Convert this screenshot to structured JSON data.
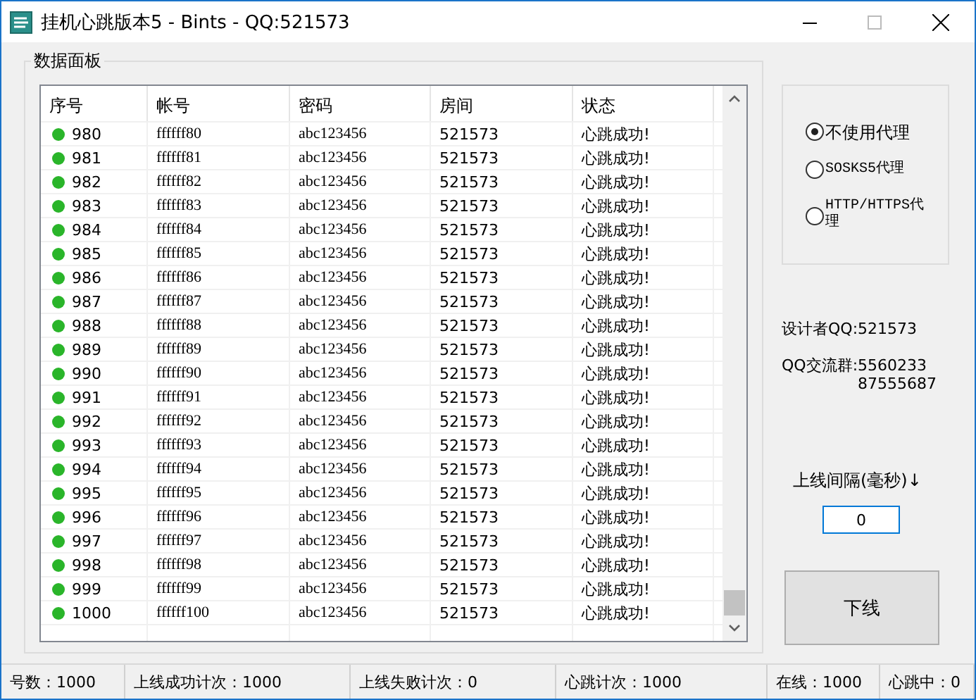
{
  "window": {
    "title": "挂机心跳版本5 - Bints - QQ:521573"
  },
  "panel": {
    "title": "数据面板"
  },
  "table": {
    "columns": [
      "序号",
      "帐号",
      "密码",
      "房间",
      "状态"
    ],
    "rows": [
      [
        "980",
        "ffffff80",
        "abc123456",
        "521573",
        "心跳成功!"
      ],
      [
        "981",
        "ffffff81",
        "abc123456",
        "521573",
        "心跳成功!"
      ],
      [
        "982",
        "ffffff82",
        "abc123456",
        "521573",
        "心跳成功!"
      ],
      [
        "983",
        "ffffff83",
        "abc123456",
        "521573",
        "心跳成功!"
      ],
      [
        "984",
        "ffffff84",
        "abc123456",
        "521573",
        "心跳成功!"
      ],
      [
        "985",
        "ffffff85",
        "abc123456",
        "521573",
        "心跳成功!"
      ],
      [
        "986",
        "ffffff86",
        "abc123456",
        "521573",
        "心跳成功!"
      ],
      [
        "987",
        "ffffff87",
        "abc123456",
        "521573",
        "心跳成功!"
      ],
      [
        "988",
        "ffffff88",
        "abc123456",
        "521573",
        "心跳成功!"
      ],
      [
        "989",
        "ffffff89",
        "abc123456",
        "521573",
        "心跳成功!"
      ],
      [
        "990",
        "ffffff90",
        "abc123456",
        "521573",
        "心跳成功!"
      ],
      [
        "991",
        "ffffff91",
        "abc123456",
        "521573",
        "心跳成功!"
      ],
      [
        "992",
        "ffffff92",
        "abc123456",
        "521573",
        "心跳成功!"
      ],
      [
        "993",
        "ffffff93",
        "abc123456",
        "521573",
        "心跳成功!"
      ],
      [
        "994",
        "ffffff94",
        "abc123456",
        "521573",
        "心跳成功!"
      ],
      [
        "995",
        "ffffff95",
        "abc123456",
        "521573",
        "心跳成功!"
      ],
      [
        "996",
        "ffffff96",
        "abc123456",
        "521573",
        "心跳成功!"
      ],
      [
        "997",
        "ffffff97",
        "abc123456",
        "521573",
        "心跳成功!"
      ],
      [
        "998",
        "ffffff98",
        "abc123456",
        "521573",
        "心跳成功!"
      ],
      [
        "999",
        "ffffff99",
        "abc123456",
        "521573",
        "心跳成功!"
      ],
      [
        "1000",
        "ffffff100",
        "abc123456",
        "521573",
        "心跳成功!"
      ]
    ]
  },
  "proxy": [
    {
      "label": "不使用代理",
      "selected": true
    },
    {
      "label": "SOSKS5代理",
      "selected": false
    },
    {
      "label": "HTTP/HTTPS代理",
      "selected": false
    }
  ],
  "designer": "设计者QQ:521573",
  "group": {
    "label": "QQ交流群:",
    "numbers": [
      "5560233",
      "87555687"
    ]
  },
  "interval": {
    "label": "上线间隔(毫秒)↓",
    "value": "0"
  },
  "offline_button": "下线",
  "status_bar": [
    "号数：1000",
    "上线成功计次：1000",
    "上线失败计次：0",
    "心跳计次：1000",
    "在线：1000",
    "心跳中：0"
  ]
}
